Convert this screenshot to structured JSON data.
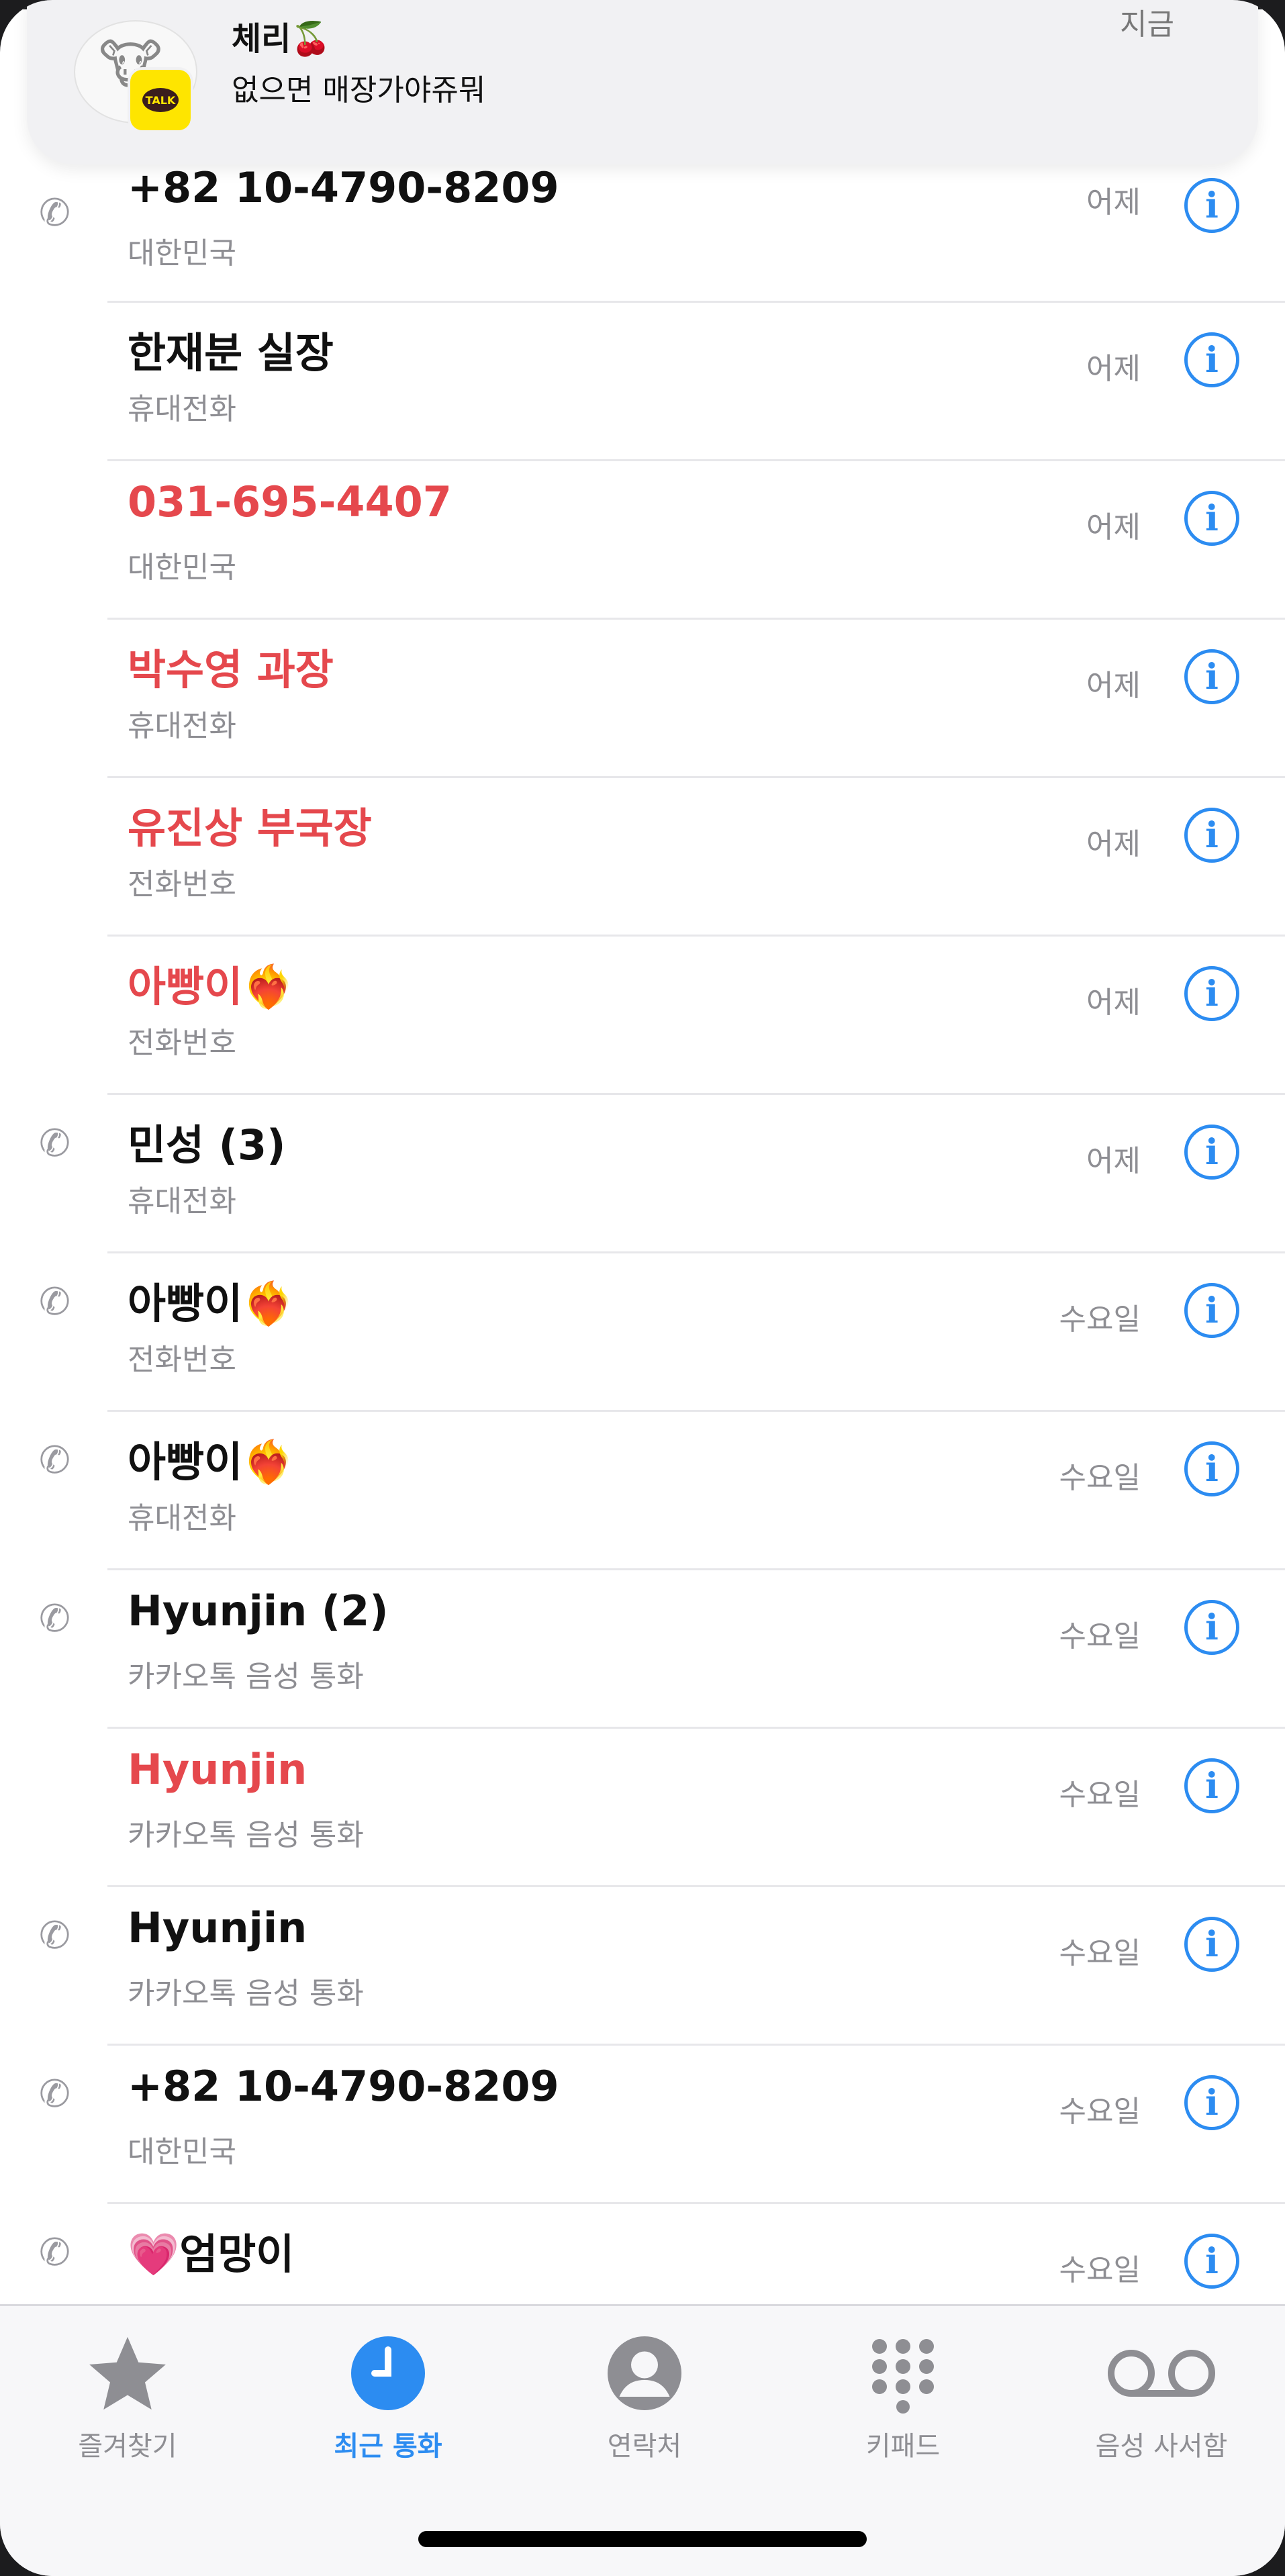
{
  "notification": {
    "app_icon": "kakaotalk-icon",
    "sender": "체리🍒",
    "message": "없으면 매장가야쥬뭐",
    "time": "지금",
    "badge_text": "TALK"
  },
  "calls": [
    {
      "name": "+82 10-4790-8209",
      "type": "대한민국",
      "date": "어제",
      "missed": false,
      "outgoing": true
    },
    {
      "name": "한재분 실장",
      "type": "휴대전화",
      "date": "어제",
      "missed": false,
      "outgoing": false
    },
    {
      "name": "031-695-4407",
      "type": "대한민국",
      "date": "어제",
      "missed": true,
      "outgoing": false
    },
    {
      "name": "박수영 과장",
      "type": "휴대전화",
      "date": "어제",
      "missed": true,
      "outgoing": false
    },
    {
      "name": "유진상 부국장",
      "type": "전화번호",
      "date": "어제",
      "missed": true,
      "outgoing": false
    },
    {
      "name": "아빵이❤️‍🔥",
      "type": "전화번호",
      "date": "어제",
      "missed": true,
      "outgoing": false
    },
    {
      "name": "민성 (3)",
      "type": "휴대전화",
      "date": "어제",
      "missed": false,
      "outgoing": true
    },
    {
      "name": "아빵이❤️‍🔥",
      "type": "전화번호",
      "date": "수요일",
      "missed": false,
      "outgoing": true
    },
    {
      "name": "아빵이❤️‍🔥",
      "type": "휴대전화",
      "date": "수요일",
      "missed": false,
      "outgoing": true
    },
    {
      "name": "Hyunjin (2)",
      "type": "카카오톡 음성 통화",
      "date": "수요일",
      "missed": false,
      "outgoing": true
    },
    {
      "name": "Hyunjin",
      "type": "카카오톡 음성 통화",
      "date": "수요일",
      "missed": true,
      "outgoing": false
    },
    {
      "name": "Hyunjin",
      "type": "카카오톡 음성 통화",
      "date": "수요일",
      "missed": false,
      "outgoing": true
    },
    {
      "name": "+82 10-4790-8209",
      "type": "대한민국",
      "date": "수요일",
      "missed": false,
      "outgoing": true
    },
    {
      "name": "💗엄망이",
      "type": "",
      "date": "수요일",
      "missed": false,
      "outgoing": true
    }
  ],
  "info_glyph": "i",
  "tabs": [
    {
      "label": "즐겨찾기",
      "icon": "star-icon",
      "active": false
    },
    {
      "label": "최근 통화",
      "icon": "clock-icon",
      "active": true
    },
    {
      "label": "연락처",
      "icon": "person-icon",
      "active": false
    },
    {
      "label": "키패드",
      "icon": "keypad-icon",
      "active": false
    },
    {
      "label": "음성 사서함",
      "icon": "voicemail-icon",
      "active": false
    }
  ],
  "colors": {
    "accent": "#2c8cf1",
    "missed": "#e5484d",
    "secondary_text": "#8e8e93",
    "kakao_yellow": "#fee500"
  }
}
